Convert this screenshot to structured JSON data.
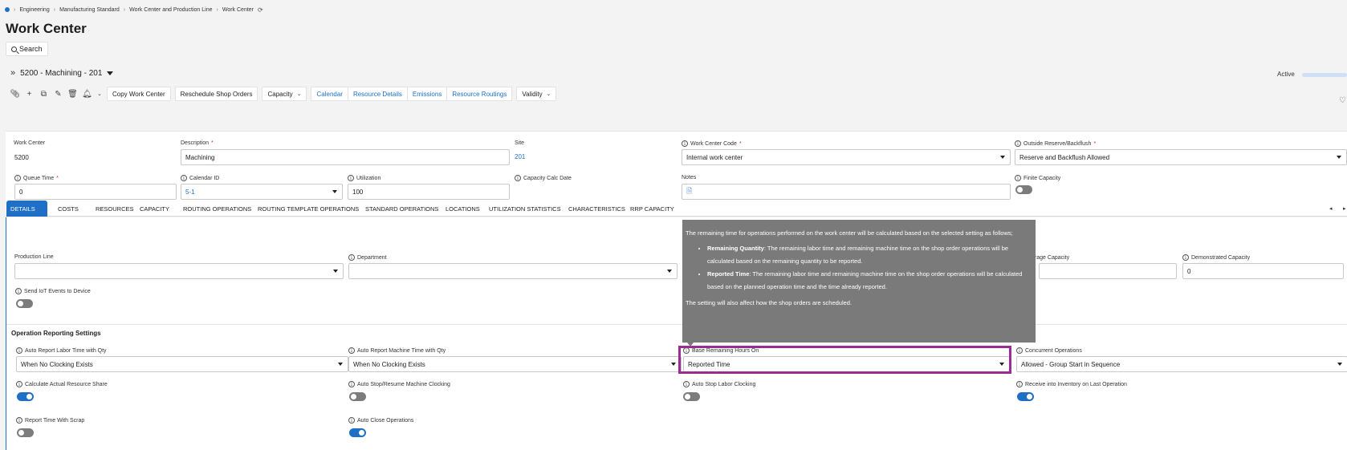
{
  "breadcrumb": [
    "Engineering",
    "Manufacturing Standard",
    "Work Center and Production Line",
    "Work Center"
  ],
  "page_title": "Work Center",
  "search_label": "Search",
  "record": {
    "title": "5200 - Machining - 201",
    "status": "Active"
  },
  "toolbar": {
    "copy": "Copy Work Center",
    "reschedule": "Reschedule Shop Orders",
    "capacity": "Capacity",
    "calendar": "Calendar",
    "resource_details": "Resource Details",
    "emissions": "Emissions",
    "resource_routings": "Resource Routings",
    "validity": "Validity"
  },
  "header": {
    "work_center_label": "Work Center",
    "work_center": "5200",
    "description_label": "Description",
    "description": "Machining",
    "site_label": "Site",
    "site": "201",
    "code_label": "Work Center Code",
    "code": "Internal work center",
    "outside_label": "Outside Reserve/Backflush",
    "outside": "Reserve and Backflush Allowed",
    "queue_label": "Queue Time",
    "queue": "0",
    "calendar_label": "Calendar ID",
    "calendar": "5-1",
    "util_label": "Utilization",
    "util": "100",
    "calc_label": "Capacity Calc Date",
    "notes_label": "Notes",
    "finite_label": "Finite Capacity",
    "required_mark": "*"
  },
  "tabs": [
    "DETAILS",
    "COSTS",
    "RESOURCES",
    "CAPACITY",
    "ROUTING OPERATIONS",
    "ROUTING TEMPLATE OPERATIONS",
    "STANDARD OPERATIONS",
    "LOCATIONS",
    "UTILIZATION STATISTICS",
    "CHARACTERISTICS",
    "RRP CAPACITY"
  ],
  "details": {
    "production_line_label": "Production Line",
    "department_label": "Department",
    "average_capacity_label": "Average Capacity",
    "demonstrated_capacity_label": "Demonstrated Capacity",
    "demonstrated_capacity": "0",
    "send_iot_label": "Send IoT Events to Device",
    "ors_title": "Operation Reporting Settings",
    "auto_labor_label": "Auto Report Labor Time with Qty",
    "auto_labor": "When No Clocking Exists",
    "auto_machine_label": "Auto Report Machine Time with Qty",
    "auto_machine": "When No Clocking Exists",
    "base_remaining_label": "Base Remaining Hours On",
    "base_remaining": "Reported Time",
    "concurrent_label": "Concurrent Operations",
    "concurrent": "Allowed - Group Start in Sequence",
    "calc_share_label": "Calculate Actual Resource Share",
    "auto_stop_resume_label": "Auto Stop/Resume Machine Clocking",
    "auto_stop_labor_label": "Auto Stop Labor Clocking",
    "receive_inv_label": "Receive into Inventory on Last Operation",
    "report_scrap_label": "Report Time With Scrap",
    "auto_close_label": "Auto Close Operations"
  },
  "toggles": {
    "finite": false,
    "send_iot": false,
    "calc_share": true,
    "auto_stop_resume": false,
    "auto_stop_labor": false,
    "receive_inv": true,
    "report_scrap": false,
    "auto_close": true
  },
  "tooltip": {
    "intro": "The remaining time for operations performed on the work center will be calculated based on the selected setting as follows;",
    "items": [
      {
        "term": "Remaining Quantity",
        "text": ": The remaining labor time and remaining machine time on the shop order operations will be calculated based on the remaining quantity to be reported."
      },
      {
        "term": "Reported Time",
        "text": ": The remaining labor time and remaining machine time on the shop order operations will be calculated based on the planned operation time and the time already reported."
      }
    ],
    "outro": "The setting will also affect how the shop orders are scheduled."
  },
  "colors": {
    "accent": "#1f6fc6",
    "highlight": "#9b2c93",
    "tooltip_bg": "#7a7a7a"
  }
}
